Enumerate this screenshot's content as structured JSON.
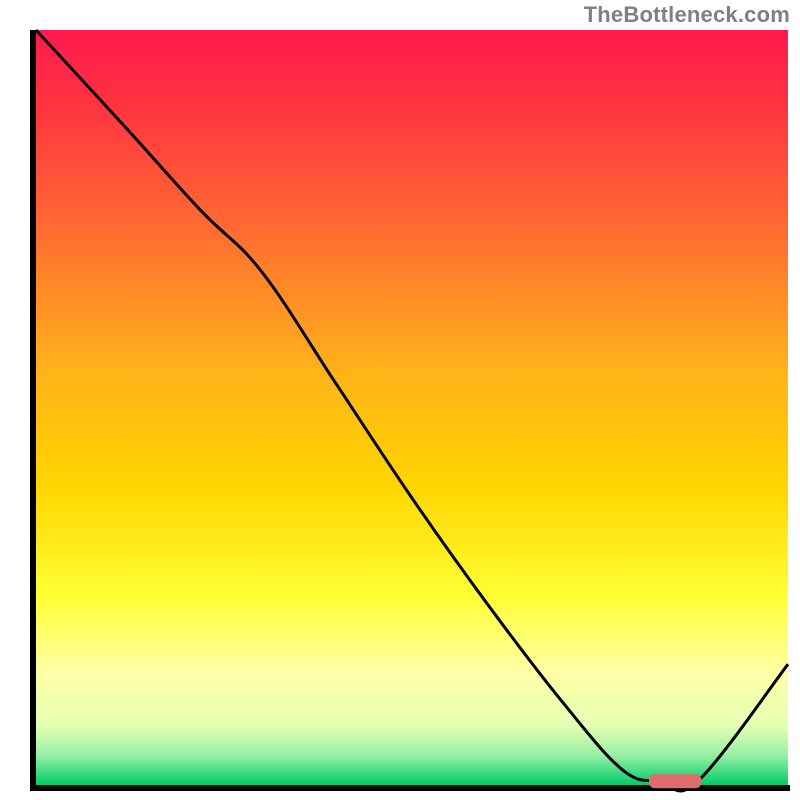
{
  "watermark": "TheBottleneck.com",
  "chart_data": {
    "type": "line",
    "title": "",
    "xlabel": "",
    "ylabel": "",
    "xlim": [
      0,
      100
    ],
    "ylim": [
      0,
      100
    ],
    "series": [
      {
        "name": "curve",
        "x": [
          0,
          12,
          22,
          30,
          40,
          50,
          60,
          70,
          78,
          83,
          88,
          100
        ],
        "values": [
          100,
          87,
          76,
          68,
          53,
          38,
          24,
          11,
          2,
          0.5,
          0.5,
          16
        ]
      }
    ],
    "marker": {
      "name": "optimal-band",
      "x_center": 85,
      "x_width": 7,
      "y": 0.5,
      "color": "#df6b6b"
    },
    "background_gradient": {
      "stops": [
        {
          "offset": 0.0,
          "color": "#ff1a4d"
        },
        {
          "offset": 0.1,
          "color": "#ff3340"
        },
        {
          "offset": 0.25,
          "color": "#ff6633"
        },
        {
          "offset": 0.45,
          "color": "#ffb21a"
        },
        {
          "offset": 0.6,
          "color": "#ffd400"
        },
        {
          "offset": 0.75,
          "color": "#ffff33"
        },
        {
          "offset": 0.85,
          "color": "#ffffa6"
        },
        {
          "offset": 0.92,
          "color": "#e6ffb3"
        },
        {
          "offset": 0.96,
          "color": "#99f0a6"
        },
        {
          "offset": 1.0,
          "color": "#00cc66"
        }
      ]
    }
  }
}
